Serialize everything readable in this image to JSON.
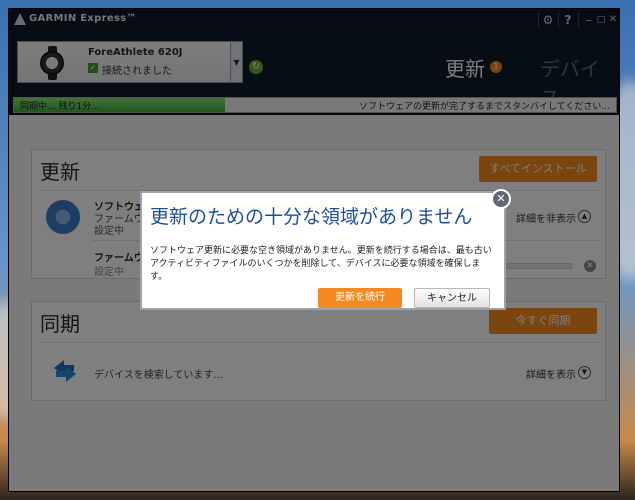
{
  "app": {
    "title": "GARMIN Express™"
  },
  "window_controls": {
    "settings_icon": "⚙",
    "help_icon": "?",
    "minimize": "–",
    "maximize": "□",
    "close": "✕"
  },
  "device": {
    "name": "ForeAthlete 620J",
    "status": "接続されました"
  },
  "nav": {
    "tab_update": "更新",
    "tab_update_badge": "1",
    "tab_devices": "デバイス"
  },
  "progress": {
    "label": "同期中... 残り1分...",
    "right_text": "ソフトウェアの更新が完了するまでスタンバイしてください...",
    "fraction": 0.35
  },
  "update_panel": {
    "title": "更新",
    "install_all": "すべてインストール",
    "rows": [
      {
        "title": "ソフトウェア",
        "subtitle": "ファームウェア",
        "status": "設定中",
        "details": "詳細を非表示"
      },
      {
        "title": "ファームウェ",
        "status": "設定中"
      }
    ]
  },
  "sync_panel": {
    "title": "同期",
    "sync_now": "今すぐ同期",
    "status": "デバイスを検索しています...",
    "details": "詳細を表示"
  },
  "dialog": {
    "title": "更新のための十分な領域がありません",
    "body": "ソフトウェア更新に必要な空き領域がありません。更新を続行する場合は、最も古いアクティビティファイルのいくつかを削除して、デバイスに必要な領域を確保します。",
    "continue_label": "更新を続行",
    "cancel_label": "キャンセル"
  }
}
